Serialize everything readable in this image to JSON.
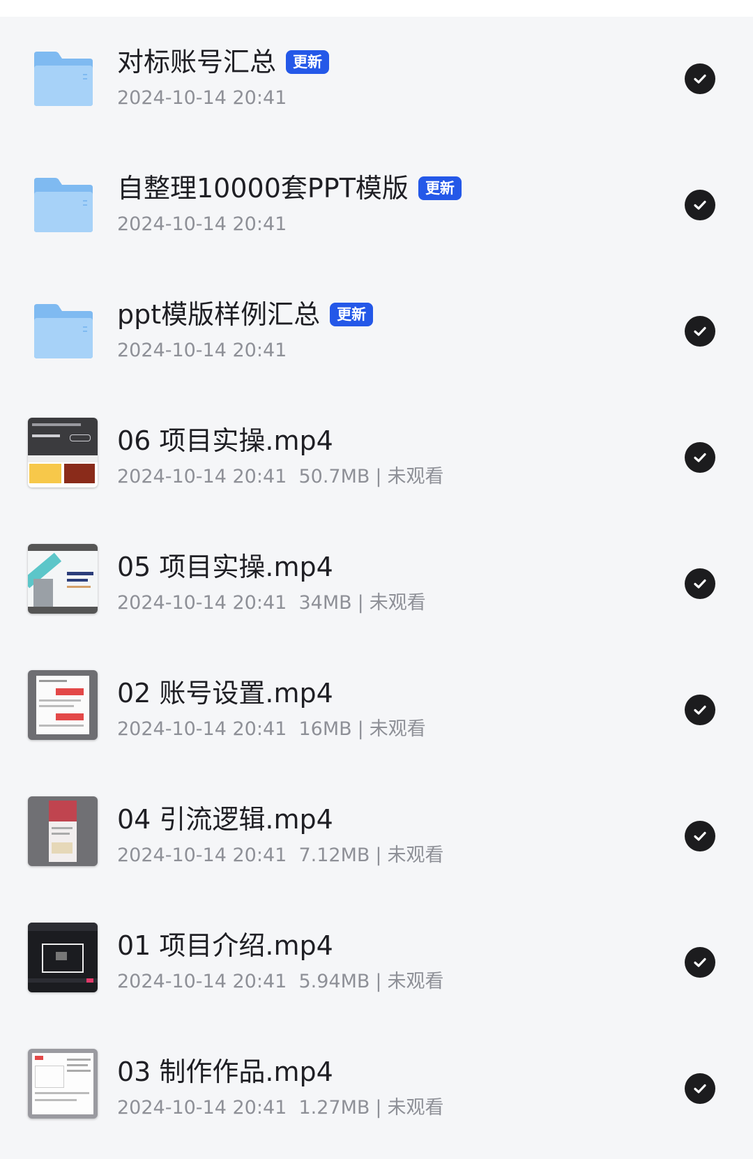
{
  "items": [
    {
      "name": "对标账号汇总",
      "badge": "更新",
      "date": "2024-10-14 20:41",
      "type": "folder"
    },
    {
      "name": "自整理10000套PPT模版",
      "badge": "更新",
      "date": "2024-10-14 20:41",
      "type": "folder"
    },
    {
      "name": "ppt模版样例汇总",
      "badge": "更新",
      "date": "2024-10-14 20:41",
      "type": "folder"
    },
    {
      "name": "06 项目实操.mp4",
      "date": "2024-10-14 20:41",
      "size": "50.7MB",
      "status": "未观看",
      "type": "video"
    },
    {
      "name": "05 项目实操.mp4",
      "date": "2024-10-14 20:41",
      "size": "34MB",
      "status": "未观看",
      "type": "video"
    },
    {
      "name": "02 账号设置.mp4",
      "date": "2024-10-14 20:41",
      "size": "16MB",
      "status": "未观看",
      "type": "video"
    },
    {
      "name": "04 引流逻辑.mp4",
      "date": "2024-10-14 20:41",
      "size": "7.12MB",
      "status": "未观看",
      "type": "video"
    },
    {
      "name": "01 项目介绍.mp4",
      "date": "2024-10-14 20:41",
      "size": "5.94MB",
      "status": "未观看",
      "type": "video"
    },
    {
      "name": "03 制作作品.mp4",
      "date": "2024-10-14 20:41",
      "size": "1.27MB",
      "status": "未观看",
      "type": "video"
    }
  ],
  "meta_separator": "|",
  "icons": {
    "folder": "folder-icon",
    "video": "video-thumbnail",
    "check": "check-circle-icon"
  },
  "colors": {
    "badge": "#2458e8",
    "folder": "#8cc4f5",
    "check": "#1c1c1e"
  }
}
